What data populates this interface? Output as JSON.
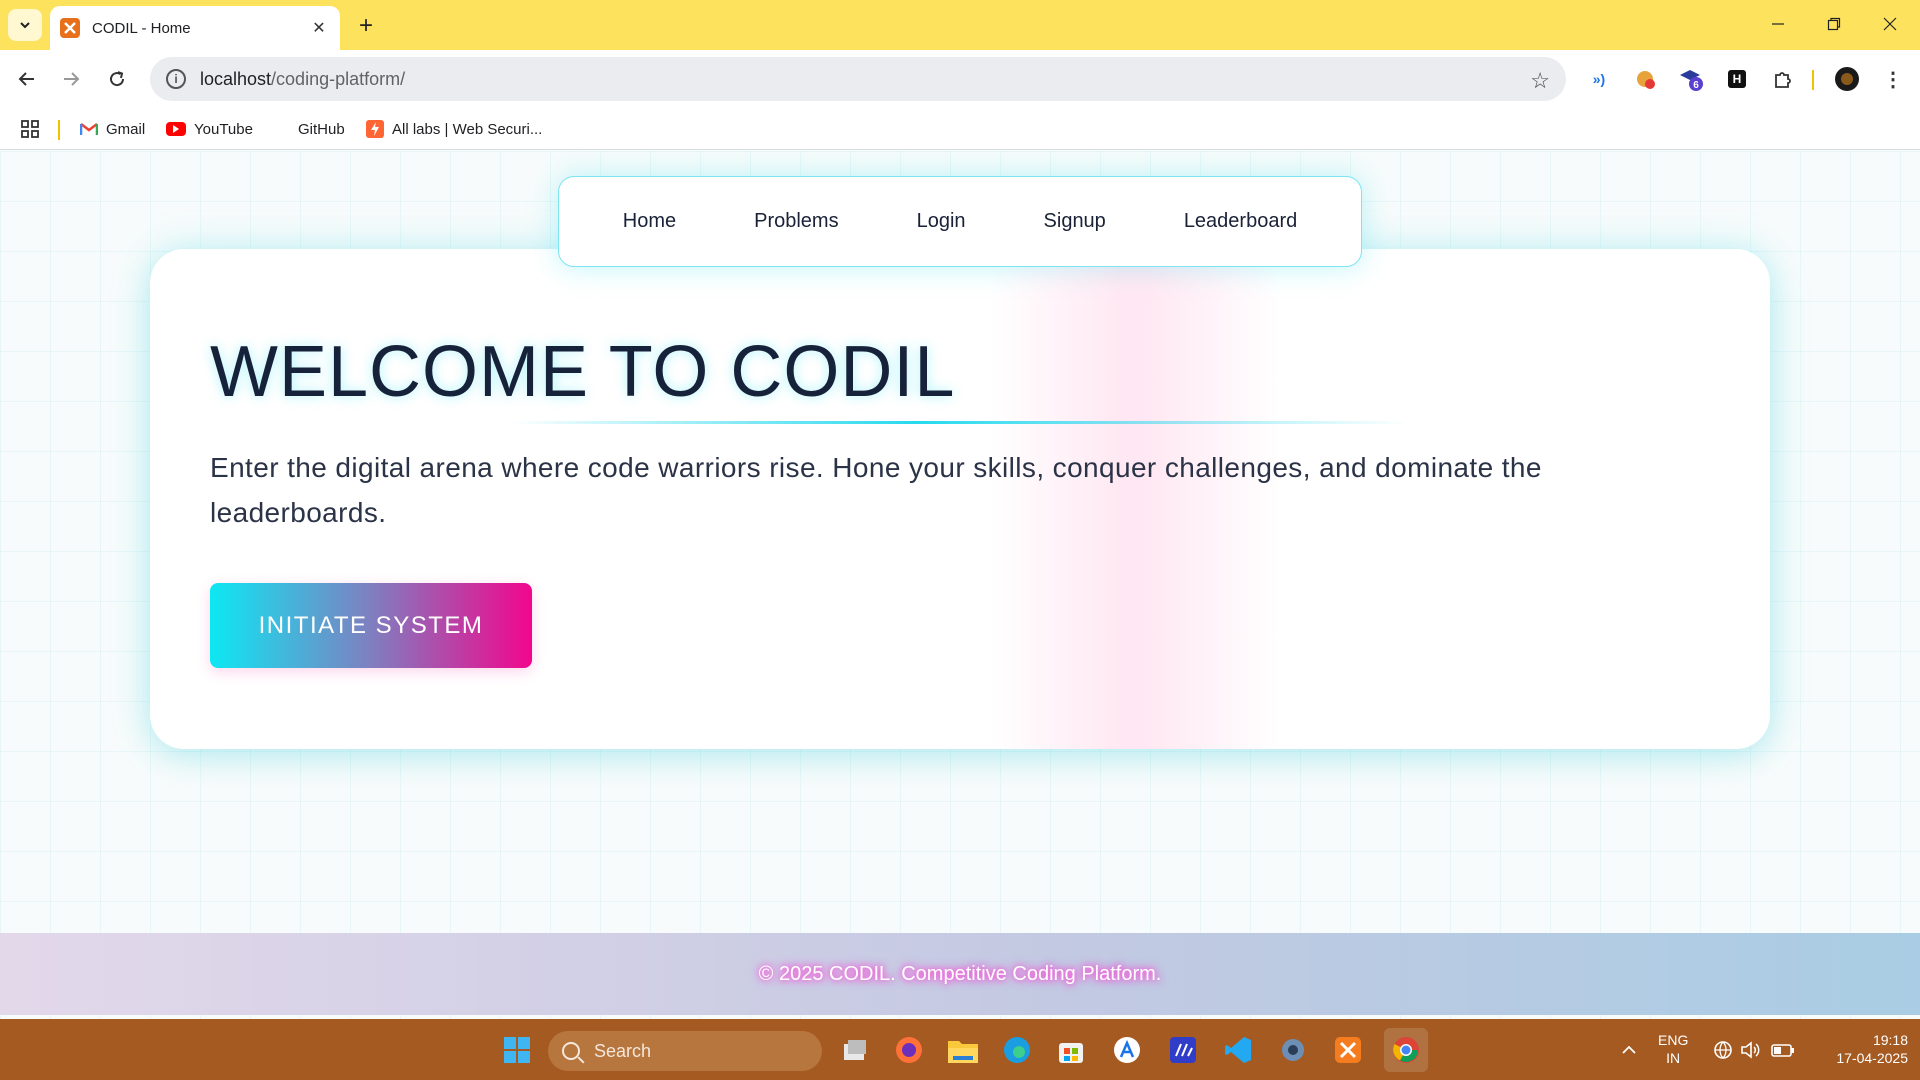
{
  "browser": {
    "tab_title": "CODIL - Home",
    "url_host": "localhost",
    "url_path": "/coding-platform/",
    "bookmarks": [
      {
        "label": "Gmail",
        "icon": "gmail-icon"
      },
      {
        "label": "YouTube",
        "icon": "youtube-icon"
      },
      {
        "label": "GitHub",
        "icon": "github-icon"
      },
      {
        "label": "All labs | Web Securi...",
        "icon": "portswigger-icon"
      }
    ],
    "extension_badge": "6",
    "accent_color": "#fde25e"
  },
  "page": {
    "nav": [
      "Home",
      "Problems",
      "Login",
      "Signup",
      "Leaderboard"
    ],
    "hero": {
      "title": "WELCOME TO CODIL",
      "text": "Enter the digital arena where code warriors rise. Hone your skills, conquer challenges, and dominate the leaderboards.",
      "cta": "INITIATE SYSTEM"
    },
    "footer": "© 2025 CODIL. Competitive Coding Platform.",
    "colors": {
      "cyan": "#0de8f3",
      "magenta": "#f2068d",
      "text_dark": "#16213a"
    }
  },
  "taskbar": {
    "search_placeholder": "Search",
    "lang": "ENG",
    "region": "IN",
    "time": "19:18",
    "date": "17-04-2025",
    "bg_color": "#a45a21"
  }
}
